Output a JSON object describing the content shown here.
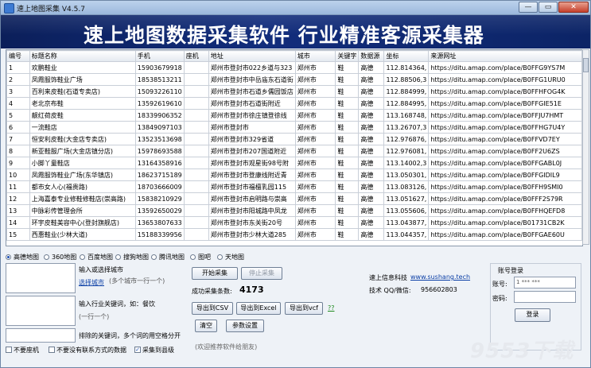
{
  "window": {
    "title": "速上地图采集 V4.5.7",
    "minimize_label": "—",
    "maximize_label": "▭",
    "close_label": "✕"
  },
  "banner": {
    "text": "速上地图数据采集软件  行业精准客源采集器"
  },
  "table": {
    "headers": [
      "编号",
      "标题名称",
      "手机",
      "座机",
      "地址",
      "城市",
      "关键字",
      "数据源",
      "坐标",
      "来源网址"
    ],
    "rows": [
      [
        "1",
        "欢鹏鞋业",
        "15903679918",
        "",
        "郑州市登封市022乡道与323",
        "郑州市",
        "鞋",
        "高德",
        "112.814364,",
        "https://ditu.amap.com/place/B0FFG9YS7M"
      ],
      [
        "2",
        "凤霞服饰鞋业广场",
        "18538513211",
        "",
        "郑州市登封市中岳庙东石道街",
        "郑州市",
        "鞋",
        "高德",
        "112.88506,3",
        "https://ditu.amap.com/place/B0FFG1URU0"
      ],
      [
        "3",
        "百利来皮鞋(石道专卖店)",
        "15093226110",
        "",
        "郑州市登封市石道乡儒园饭店",
        "郑州市",
        "鞋",
        "高德",
        "112.884999,",
        "https://ditu.amap.com/place/B0FFHFOG4K"
      ],
      [
        "4",
        "老北京布鞋",
        "13592619610",
        "",
        "郑州市登封市石道街附近",
        "郑州市",
        "鞋",
        "高德",
        "112.884995,",
        "https://ditu.amap.com/place/B0FFGIE51E"
      ],
      [
        "5",
        "靓红荷皮鞋",
        "18339906352",
        "",
        "郑州市登封市徐庄镇登徐线",
        "郑州市",
        "鞋",
        "高德",
        "113.168748,",
        "https://ditu.amap.com/place/B0FFJU7HMT"
      ],
      [
        "6",
        "一流鞋店",
        "13849097103",
        "",
        "郑州市登封市",
        "郑州市",
        "鞋",
        "高德",
        "113.26707,3",
        "https://ditu.amap.com/place/B0FFHG7U4Y"
      ],
      [
        "7",
        "恒安利皮鞋(大金店专卖店)",
        "13523513698",
        "",
        "郑州市登封市329省道",
        "郑州市",
        "鞋",
        "高德",
        "112.976876,",
        "https://ditu.amap.com/place/B0FFVD7EY"
      ],
      [
        "8",
        "新亚鞋服广场(大金店镇分店)",
        "15978693588",
        "",
        "郑州市登封市207国道附近",
        "郑州市",
        "鞋",
        "高德",
        "112.976081,",
        "https://ditu.amap.com/place/B0FF2U6ZS"
      ],
      [
        "9",
        "小脚丫童鞋店",
        "13164358916",
        "",
        "郑州市登封市观星街98号附",
        "郑州市",
        "鞋",
        "高德",
        "113.14002,3",
        "https://ditu.amap.com/place/B0FFGABL0J"
      ],
      [
        "10",
        "凤霞服饰鞋业广场(东华镇店)",
        "18623715189",
        "",
        "郑州市登封市登康线附近青",
        "郑州市",
        "鞋",
        "高德",
        "113.050301,",
        "https://ditu.amap.com/place/B0FFGIDIL9"
      ],
      [
        "11",
        "都市女人心(福贵路)",
        "18703666009",
        "",
        "郑州市登封市福檀乳园115",
        "郑州市",
        "鞋",
        "高德",
        "113.083126,",
        "https://ditu.amap.com/place/B0FFH9SMI0"
      ],
      [
        "12",
        "上海嘉泰专业修鞋修鞋店(崇高路)",
        "15838210929",
        "",
        "郑州市登封市启明路与崇高",
        "郑州市",
        "鞋",
        "高德",
        "113.051627,",
        "https://ditu.amap.com/place/B0FFF2S79R"
      ],
      [
        "13",
        "中脉彩传管理会所",
        "13592650029",
        "",
        "郑州市登封市阳城路中凤龙",
        "郑州市",
        "鞋",
        "高德",
        "113.055606,",
        "https://ditu.amap.com/place/B0FFHQEFD8"
      ],
      [
        "14",
        "环宇皮鞋美容中心(登封旗舰店)",
        "13653807633",
        "",
        "郑州市登封市东关街20号",
        "郑州市",
        "鞋",
        "高德",
        "113.043877,",
        "https://ditu.amap.com/place/B01731CB2K"
      ],
      [
        "15",
        "西惠鞋业(少林大道)",
        "15188339956",
        "",
        "郑州市登封市少林大道285",
        "郑州市",
        "鞋",
        "高德",
        "113.044357,",
        "https://ditu.amap.com/place/B0FFGAE60U"
      ]
    ]
  },
  "map_sources": {
    "options": [
      "高德地图",
      "360地图",
      "百度地图",
      "搜狗地图",
      "腾讯地图",
      "图吧",
      "天地图"
    ],
    "selected": "高德地图"
  },
  "city_section": {
    "label": "输入或选择城市",
    "select_link": "选择城市",
    "hint": "(多个城市一行一个)"
  },
  "keyword_section": {
    "label": "输入行业关键词，如：餐饮",
    "hint": "(一行一个)",
    "exclude_label": "排除的关键词，多个词的用空格分开"
  },
  "checkboxes": {
    "no_landline": "不要座机",
    "no_contact": "不要没有联系方式的数据",
    "collect_county": "采集到县级"
  },
  "controls": {
    "start": "开始采集",
    "stop": "停止采集",
    "success_label": "成功采集条数:",
    "success_count": "4173",
    "export_csv": "导出到CSV",
    "export_excel": "导出到Excel",
    "export_vcf": "导出到vcf",
    "help": "??",
    "clear": "清空",
    "settings": "参数设置",
    "recommend": "(欢迎推荐软件给朋友)"
  },
  "company": {
    "name": "速上信息科技",
    "website": "www.sushang.tech",
    "contact_label": "技术 QQ/微信:",
    "contact_value": "956602803"
  },
  "login": {
    "title": "账号登录",
    "account_label": "账号:",
    "account_value": "1 *** ***",
    "password_label": "密码:",
    "login_button": "登录"
  },
  "watermark": {
    "text": "9553下载"
  }
}
